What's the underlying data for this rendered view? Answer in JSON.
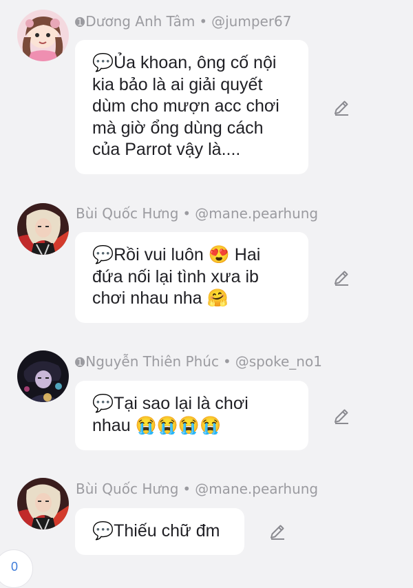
{
  "comments": [
    {
      "name": "Dương Anh Tâm",
      "badge": "➊",
      "separator": "•",
      "handle": "@jumper67",
      "text": "💬Ủa khoan, ông cố nội\nkia bảo là ai giải quyết\ndùm cho mượn acc chơi\nmà giờ ổng dùng cách\ncủa Parrot vậy là....",
      "avatar_icon": "avatar-pink-hair-girl"
    },
    {
      "name": "Bùi Quốc Hưng",
      "badge": "",
      "separator": "•",
      "handle": "@mane.pearhung",
      "text": "💬Rồi vui luôn 😍 Hai\nđứa nối lại tình xưa ib\nchơi nhau nha 🤗",
      "avatar_icon": "avatar-white-hair-red"
    },
    {
      "name": "Nguyễn Thiên Phúc",
      "badge": "➊",
      "separator": "•",
      "handle": "@spoke_no1",
      "text": "💬Tại sao lại là chơi\nnhau 😭😭😭😭",
      "avatar_icon": "avatar-dark-boy"
    },
    {
      "name": "Bùi Quốc Hưng",
      "badge": "",
      "separator": "•",
      "handle": "@mane.pearhung",
      "text": "💬Thiếu chữ đm",
      "avatar_icon": "avatar-white-hair-red"
    }
  ],
  "counter": {
    "value": "0"
  },
  "colors": {
    "background": "#f2f2f4",
    "bubble": "#ffffff",
    "meta_text": "#9b9ba0",
    "body_text": "#1f1f24",
    "edit_icon": "#8a8a90",
    "counter_text": "#3d7bd8"
  }
}
